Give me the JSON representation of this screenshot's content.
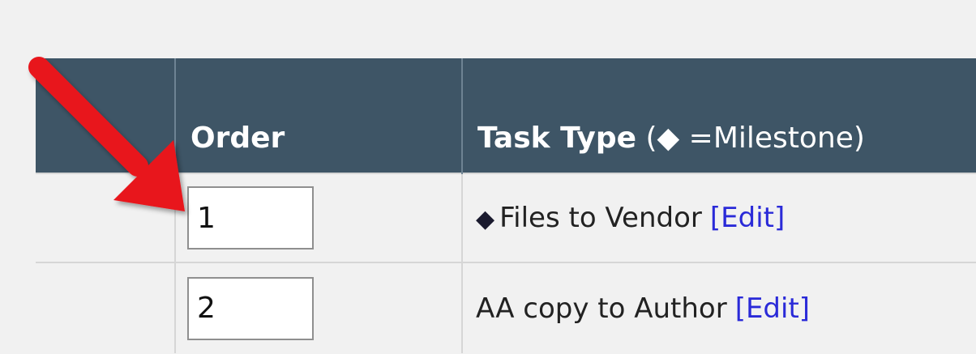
{
  "table": {
    "columns": [
      {
        "bold": "",
        "normal": ""
      },
      {
        "bold": "Order",
        "normal": ""
      },
      {
        "bold": "Task Type",
        "normal": " (◆ =Milestone)"
      }
    ],
    "rows": [
      {
        "order": "1",
        "milestone_marker": "◆",
        "task_type": "Files to Vendor",
        "edit_label": "[Edit]"
      },
      {
        "order": "2",
        "milestone_marker": "",
        "task_type": "AA copy to Author",
        "edit_label": "[Edit]"
      }
    ]
  },
  "icons": {
    "annotation": "red-arrow-icon",
    "milestone": "diamond-icon"
  },
  "colors": {
    "header_bg": "#3e5566",
    "link": "#2a2ad8",
    "arrow": "#e8141b"
  }
}
